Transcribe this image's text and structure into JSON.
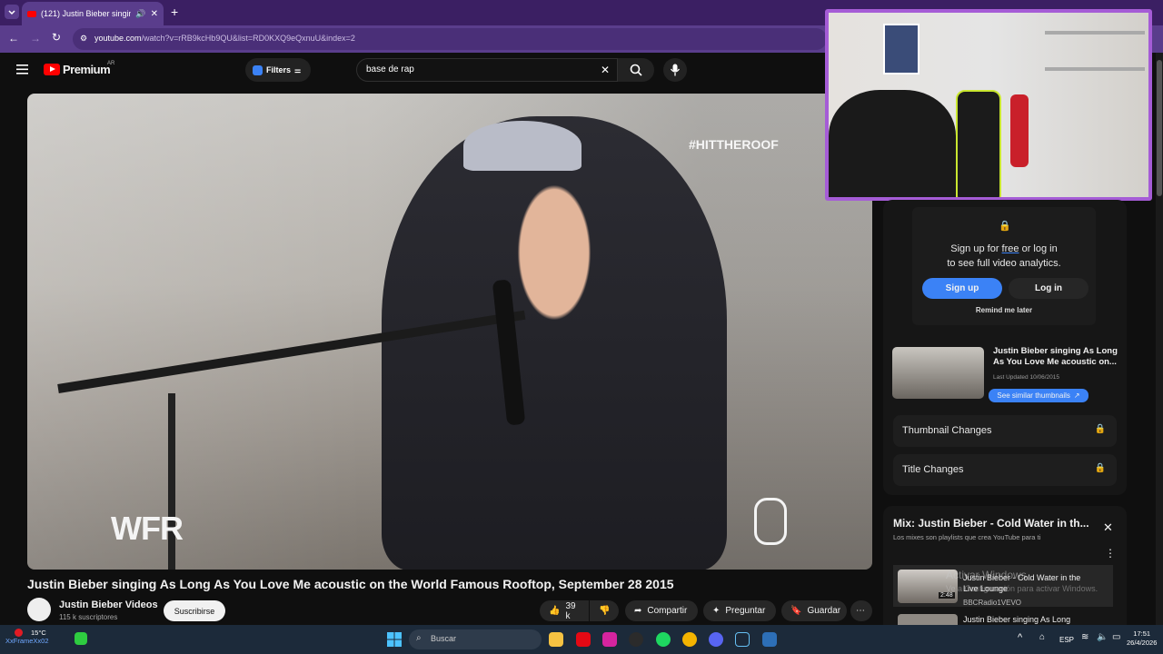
{
  "browser": {
    "tab_title": "(121) Justin Bieber singing",
    "url_host": "youtube.com",
    "url_path": "/watch?v=rRB9kcHb9QU&list=RD0KXQ9eQxnuU&index=2"
  },
  "youtube": {
    "logo_text": "Premium",
    "logo_region": "AR",
    "filters_label": "Filters",
    "search_value": "base de rap"
  },
  "video": {
    "hashtag": "#HITTHEROOF",
    "watermark": "WFR",
    "title": "Justin Bieber singing As Long As You Love Me acoustic on the World Famous Rooftop, September 28 2015",
    "channel": "Justin Bieber Videos",
    "subscribers": "115 k suscriptores",
    "subscribe_label": "Suscribirse",
    "likes": "39 k",
    "share_label": "Compartir",
    "ask_label": "Preguntar",
    "save_label": "Guardar"
  },
  "analytics": {
    "signup_prefix": "Sign up for ",
    "signup_free": "free",
    "signup_suffix": " or log in",
    "signup_line2": "to see full video analytics.",
    "signup_btn": "Sign up",
    "login_btn": "Log in",
    "remind": "Remind me later",
    "thumb_title": "Justin Bieber singing As Long As You Love Me acoustic on...",
    "last_updated": "Last Updated 10/06/2015",
    "similar_btn": "See similar thumbnails",
    "row1": "Thumbnail Changes",
    "row2": "Title Changes"
  },
  "mix": {
    "title": "Mix: Justin Bieber - Cold Water in th...",
    "subtitle": "Los mixes son playlists que crea YouTube para ti",
    "item1_title": "Justin Bieber - Cold Water in the Live Lounge",
    "item1_channel": "BBCRadio1VEVO",
    "item1_duration": "2:48",
    "item2_title": "Justin Bieber singing As Long"
  },
  "windows": {
    "activate_title": "Activar Windows",
    "activate_sub": "Ve a Configuración para activar Windows.",
    "search_placeholder": "Buscar",
    "temp": "15°C",
    "weather_user": "XxFrameXx02",
    "lang": "ESP",
    "time": "17:51",
    "date": "26/4/2026"
  },
  "colors": {
    "accent": "#3b82f6",
    "youtube_red": "#ff0000",
    "chrome_purple": "#5a3d8c",
    "webcam_border": "#a55cd6"
  }
}
